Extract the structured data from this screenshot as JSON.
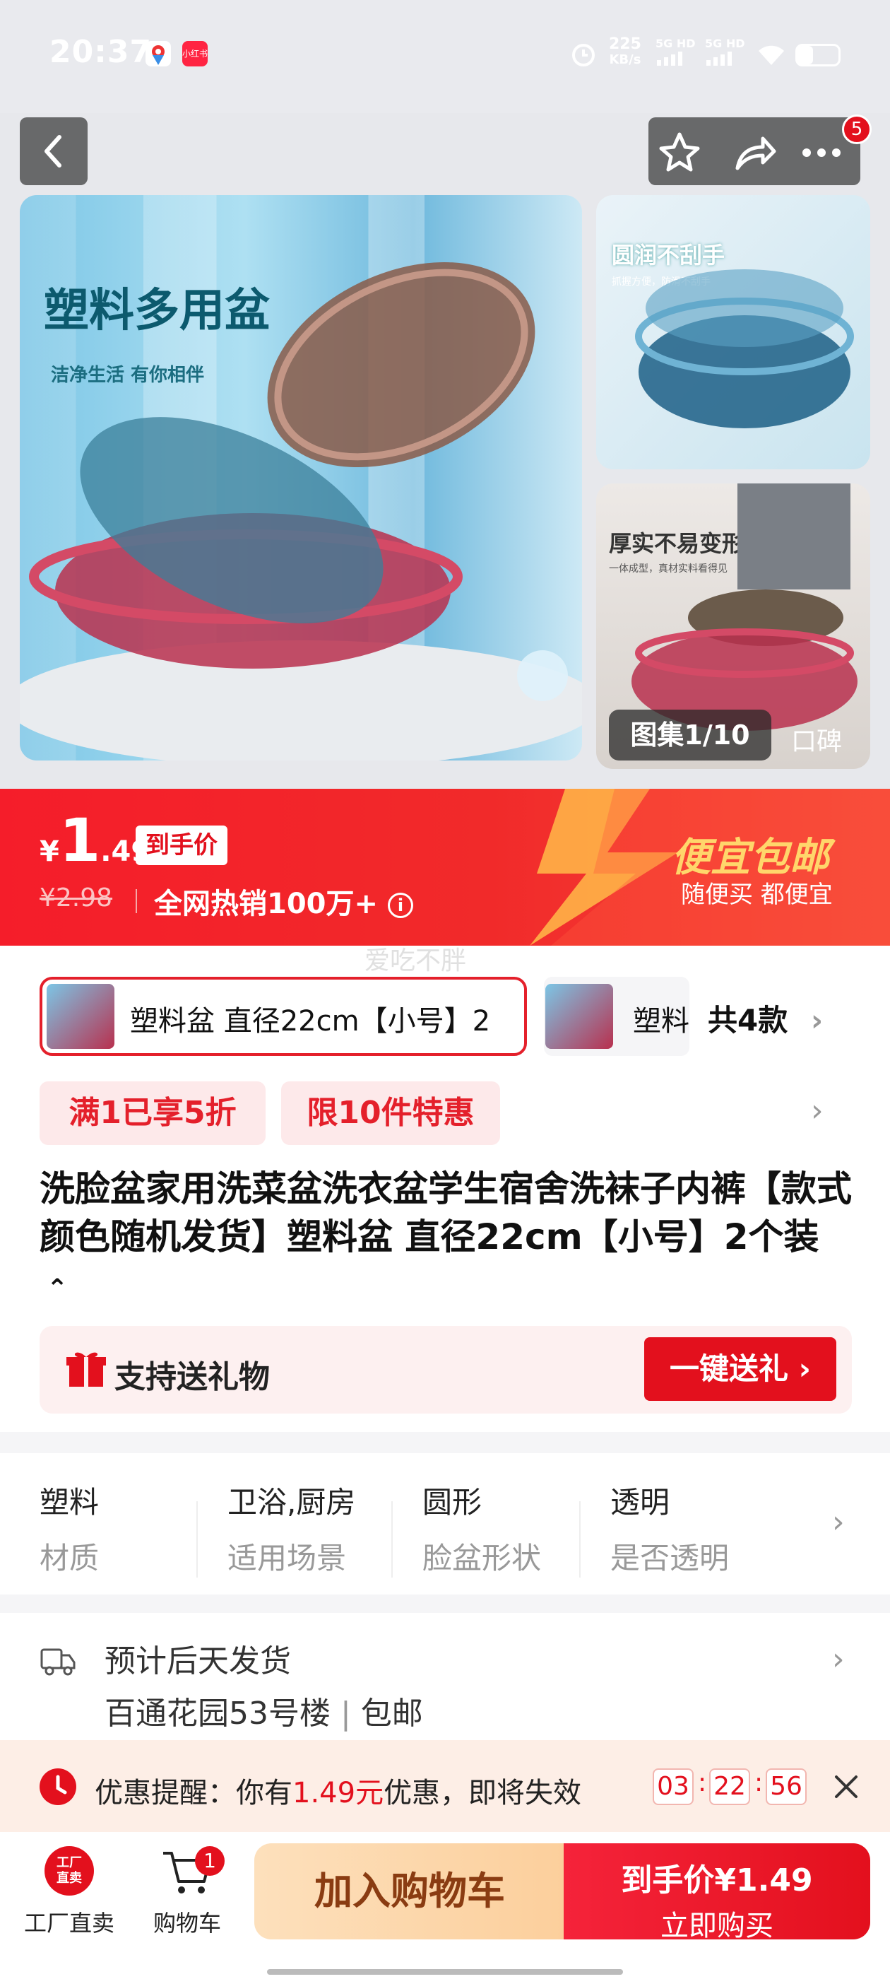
{
  "status_bar": {
    "time": "20:37",
    "network_speed": "225",
    "network_unit": "KB/s",
    "sig1": "5G HD",
    "sig2": "5G HD"
  },
  "header": {
    "notif_count": "5"
  },
  "gallery": {
    "main_title": "塑料多用盆",
    "main_sub": "洁净生活 有你相伴",
    "side1_title": "圆润不刮手",
    "side1_sub": "抓握方便，防滑不刮手",
    "side2_title": "厚实不易变形",
    "side2_sub": "一体成型，真材实料看得见",
    "counter": "图集1/10",
    "review_tab": "口碑"
  },
  "price": {
    "currency": "¥",
    "integer": "1",
    "decimal": ".49",
    "badge": "到手价",
    "original": "¥2.98",
    "sales": "全网热销100万+",
    "promo_title": "便宜包邮",
    "promo_sub": "随便买 都便宜",
    "watermark": "爱吃不胖"
  },
  "sku": {
    "selected": "塑料盆 直径22cm【小号】2",
    "second": "塑料",
    "total": "共4款"
  },
  "tags": [
    "满1已享5折",
    "限10件特惠"
  ],
  "product": {
    "title": "洗脸盆家用洗菜盆洗衣盆学生宿舍洗袜子内裤【款式颜色随机发货】塑料盆 直径22cm【小号】2个装"
  },
  "gift": {
    "label": "支持送礼物",
    "button": "一键送礼"
  },
  "attributes": [
    {
      "value": "塑料",
      "key": "材质"
    },
    {
      "value": "卫浴,厨房",
      "key": "适用场景"
    },
    {
      "value": "圆形",
      "key": "脸盆形状"
    },
    {
      "value": "透明",
      "key": "是否透明"
    }
  ],
  "shipping": {
    "line1": "预计后天发货",
    "address": "百通花园53号楼",
    "free": "包邮"
  },
  "promo_bar": {
    "prefix": "优惠提醒：你有",
    "amount": "1.49元",
    "suffix": "优惠，即将失效",
    "h": "03",
    "m": "22",
    "s": "56"
  },
  "bottom": {
    "factory_badge": "工厂直卖",
    "factory_label": "工厂直卖",
    "cart_label": "购物车",
    "cart_count": "1",
    "add_cart": "加入购物车",
    "buy_price": "到手价¥1.49",
    "buy_now": "立即购买"
  },
  "colors": {
    "accent": "#e3101d",
    "promo_gold": "#ffd66b"
  }
}
